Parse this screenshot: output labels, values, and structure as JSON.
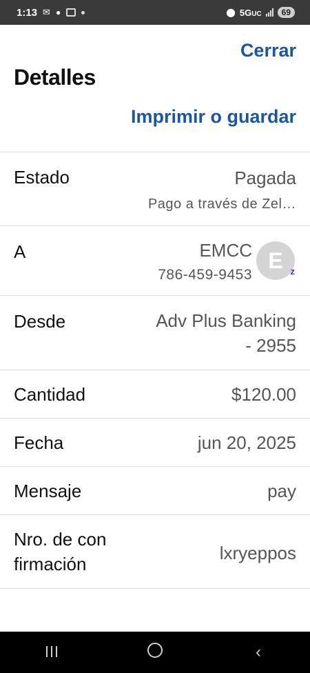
{
  "status_bar": {
    "time": "1:13",
    "network": "5G",
    "network_sub": "UC",
    "battery": "69"
  },
  "header": {
    "close_label": "Cerrar",
    "title": "Detalles",
    "print_label": "Imprimir o guardar"
  },
  "details": {
    "estado": {
      "label": "Estado",
      "value": "Pagada",
      "sub": "Pago a través de Zel…"
    },
    "recipient": {
      "label": "A",
      "name": "EMCC",
      "phone": "786-459-9453",
      "avatar_letter": "E",
      "badge": "z"
    },
    "desde": {
      "label": "Desde",
      "value_line1": "Adv Plus Banking",
      "value_line2": "- 2955"
    },
    "cantidad": {
      "label": "Cantidad",
      "value": "$120.00"
    },
    "fecha": {
      "label": "Fecha",
      "value": "jun 20, 2025"
    },
    "mensaje": {
      "label": "Mensaje",
      "value": "pay"
    },
    "confirmacion": {
      "label_line1": "Nro. de con",
      "label_line2": "firmación",
      "value": "lxryeppos"
    }
  },
  "colors": {
    "accent_link": "#1a56a8",
    "zelle_purple": "#6d1ed4",
    "status_bar_bg": "#3a3a3a",
    "nav_bar_bg": "#000000"
  },
  "icons": {
    "status_left": [
      "gmail-icon",
      "chat-icon",
      "snapchat-icon",
      "dot-icon"
    ],
    "status_right": [
      "location-icon",
      "signal-icon",
      "battery-icon"
    ],
    "nav": [
      "recents-icon",
      "home-icon",
      "back-icon"
    ]
  }
}
